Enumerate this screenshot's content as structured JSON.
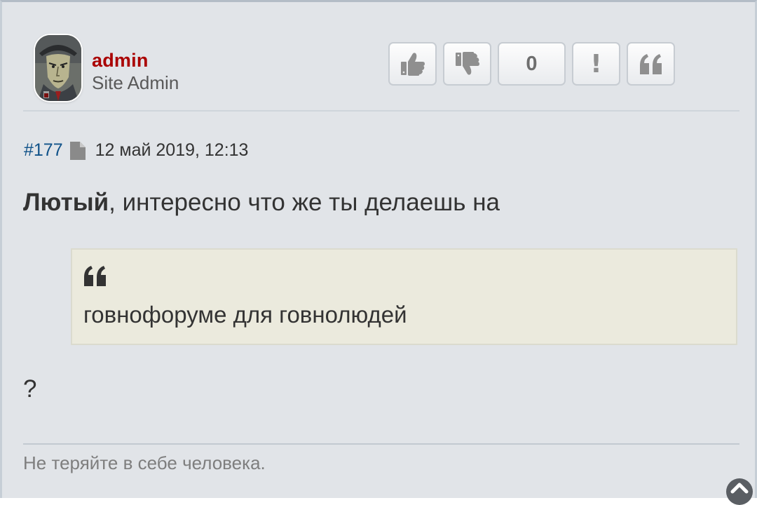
{
  "author": {
    "username": "admin",
    "rank": "Site Admin",
    "username_color": "#aa0000",
    "avatar_icon": "avatar-noir-character"
  },
  "actions": {
    "like_icon": "thumbs-up-icon",
    "dislike_icon": "thumbs-down-icon",
    "rating_count": "0",
    "report_label": "!",
    "quote_icon": "quote-icon"
  },
  "meta": {
    "post_number": "#177",
    "file_icon": "file-icon",
    "date": "12 май 2019, 12:13"
  },
  "content": {
    "mention": "Лютый",
    "text_after_mention": ", интересно что же ты делаешь на",
    "quote_text": "говнофоруме для говнолюдей",
    "trailing_text": "?"
  },
  "signature": {
    "text": "Не теряйте в себе человека."
  },
  "scroll_top_icon": "chevron-up-circle-icon",
  "colors": {
    "link": "#105289",
    "panel_bg": "#e1e4e8",
    "quote_bg": "#ebeadd"
  }
}
